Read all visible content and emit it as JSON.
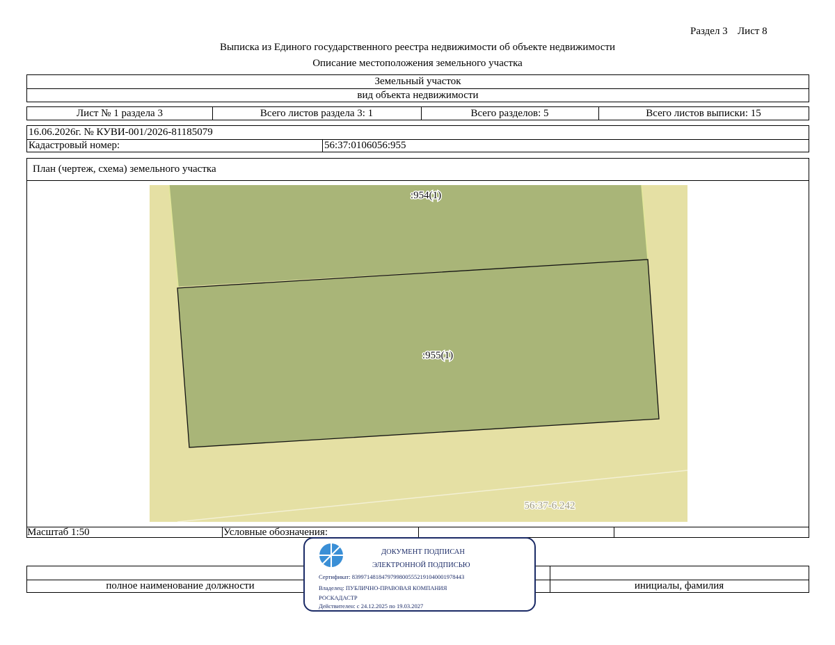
{
  "header": {
    "section": "Раздел 3",
    "sheet": "Лист 8",
    "title": "Выписка из Единого государственного реестра недвижимости об объекте недвижимости",
    "subtitle": "Описание местоположения земельного участка"
  },
  "object": {
    "type_value": "Земельный участок",
    "type_caption": "вид объекта недвижимости"
  },
  "sheets_row": {
    "sheet_of_section": "Лист № 1 раздела 3",
    "total_sheets_section": "Всего листов раздела 3: 1",
    "total_sections": "Всего разделов: 5",
    "total_sheets_extract": "Всего листов выписки: 15"
  },
  "record": {
    "date_number": "16.06.2026г. № КУВИ-001/2026-81185079",
    "cadastral_label": "Кадастровый номер:",
    "cadastral_value": "56:37:0106056:955"
  },
  "plan": {
    "title": "План (чертеж, схема) земельного участка",
    "labels": {
      "parcel_954": ":954(1)",
      "parcel_955": ":955(1)",
      "quarter": "56:37-6.242"
    },
    "colors": {
      "background": "#e5e0a4",
      "parcel": "#a9b578",
      "quarter_label": "#9e9a7a"
    }
  },
  "bottom_row": {
    "scale": "Масштаб 1:50",
    "legend": "Условные обозначения:"
  },
  "signature_row": {
    "position": "полное наименование должности",
    "initials": "инициалы, фамилия"
  },
  "stamp": {
    "line1": "ДОКУМЕНТ ПОДПИСАН",
    "line2": "ЭЛЕКТРОННОЙ ПОДПИСЬЮ",
    "certificate": "Сертификат: 8399714818479799800555219104000197844З",
    "owner": "Владелец: ПУБЛИЧНО-ПРАВОВАЯ КОМПАНИЯ",
    "owner2": "РОСКАДАСТР",
    "valid": "Действителен: с 24.12.2025 по 19.03.2027",
    "color": "#1a2a66"
  }
}
